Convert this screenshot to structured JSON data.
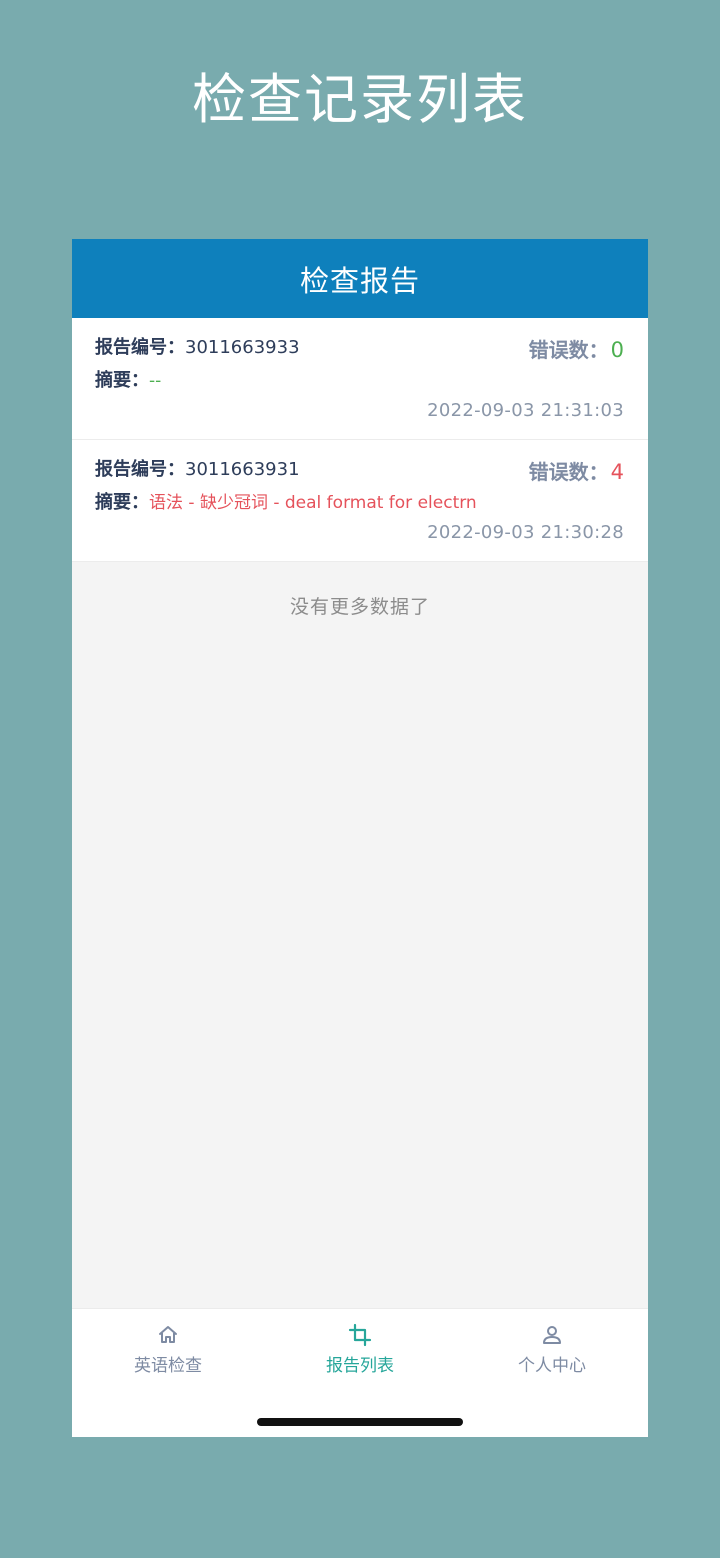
{
  "promo": {
    "title": "检查记录列表"
  },
  "nav": {
    "title": "检查报告"
  },
  "labels": {
    "report_id": "报告编号：",
    "summary": "摘要：",
    "error_count": "错误数："
  },
  "reports": [
    {
      "id": "3011663933",
      "error_count": "0",
      "summary": "--",
      "time": "2022-09-03 21:31:03",
      "status_color": "#4caf50"
    },
    {
      "id": "3011663931",
      "error_count": "4",
      "summary": "语法 - 缺少冠词 - deal format for electrn",
      "time": "2022-09-03 21:30:28",
      "status_color": "#e5525b"
    }
  ],
  "list_end": {
    "text": "没有更多数据了"
  },
  "tabs": [
    {
      "label": "英语检查",
      "icon": "home-icon",
      "active": false
    },
    {
      "label": "报告列表",
      "icon": "crop-icon",
      "active": true
    },
    {
      "label": "个人中心",
      "icon": "user-icon",
      "active": false
    }
  ],
  "colors": {
    "background": "#79abae",
    "nav": "#0e80bc",
    "accent": "#26a69a",
    "success": "#4caf50",
    "danger": "#e5525b"
  }
}
